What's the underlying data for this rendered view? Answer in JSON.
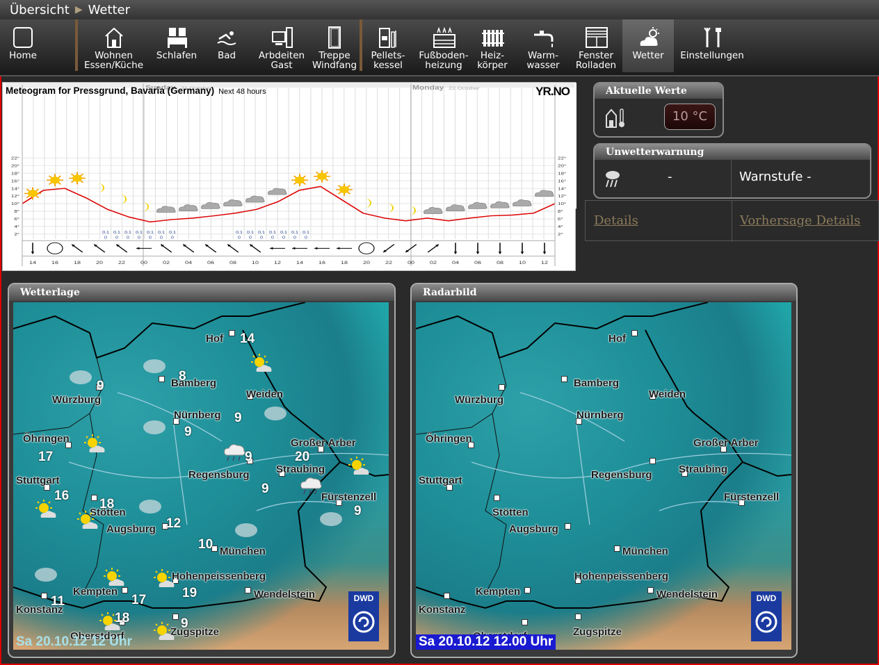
{
  "breadcrumb": {
    "parent": "Übersicht",
    "current": "Wetter"
  },
  "toolbar": [
    {
      "id": "home",
      "line1": "Home",
      "line2": "",
      "icon": "home-icon"
    },
    {
      "id": "wohnen",
      "line1": "Wohnen",
      "line2": "Essen/Küche",
      "icon": "house-icon"
    },
    {
      "id": "schlafen",
      "line1": "Schlafen",
      "line2": "",
      "icon": "bed-icon"
    },
    {
      "id": "bad",
      "line1": "Bad",
      "line2": "",
      "icon": "swimmer-icon"
    },
    {
      "id": "arbeiten",
      "line1": "Arbdeiten",
      "line2": "Gast",
      "icon": "computer-icon"
    },
    {
      "id": "treppe",
      "line1": "Treppe",
      "line2": "Windfang",
      "icon": "door-icon"
    },
    {
      "id": "pellets",
      "line1": "Pellets-",
      "line2": "kessel",
      "icon": "boiler-icon"
    },
    {
      "id": "fussboden",
      "line1": "Fußboden-",
      "line2": "heizung",
      "icon": "floor-heating-icon"
    },
    {
      "id": "heizkoerper",
      "line1": "Heiz-",
      "line2": "körper",
      "icon": "radiator-icon"
    },
    {
      "id": "warmwasser",
      "line1": "Warm-",
      "line2": "wasser",
      "icon": "faucet-icon"
    },
    {
      "id": "fenster",
      "line1": "Fenster",
      "line2": "Rolladen",
      "icon": "window-blind-icon"
    },
    {
      "id": "wetter",
      "line1": "Wetter",
      "line2": "",
      "icon": "weather-icon"
    },
    {
      "id": "einstellungen",
      "line1": "Einstellungen",
      "line2": "",
      "icon": "tools-icon"
    }
  ],
  "meteogram": {
    "title": "Meteogram for Pressgrund, Bavaria (Germany)",
    "subtitle": "Next 48 hours",
    "logo": "YR.NO",
    "day1": "Sunday",
    "day1_date": "21 October",
    "day2": "Monday",
    "day2_date": "22 October"
  },
  "chart_data": {
    "type": "line",
    "title": "Meteogram for Pressgrund, Bavaria (Germany)",
    "x": [
      "14",
      "16",
      "18",
      "20",
      "22",
      "00",
      "02",
      "04",
      "06",
      "08",
      "10",
      "12",
      "14",
      "16",
      "18",
      "20",
      "22",
      "00",
      "02",
      "04",
      "06",
      "08",
      "10",
      "12"
    ],
    "ylim": [
      0,
      23
    ],
    "ytick_labels": [
      "2°",
      "4°",
      "6°",
      "8°",
      "10°",
      "12°",
      "14°",
      "16°",
      "18°",
      "20°",
      "22°"
    ],
    "series": [
      {
        "values": [
          10,
          13.5,
          14,
          11.5,
          8.5,
          6.5,
          5.2,
          5.8,
          6.2,
          6.8,
          7.5,
          8.5,
          10.5,
          13.5,
          14.5,
          11,
          7.5,
          6.2,
          5.5,
          6.2,
          5.5,
          6.2,
          6.8,
          7,
          7.5,
          10
        ]
      }
    ],
    "precipitation": [
      "0.1",
      "0.1",
      "0.1",
      "0.1",
      "0.1",
      "0.1",
      "0.1"
    ],
    "precip_zero": "0",
    "symbols": [
      "sun",
      "sun",
      "sun",
      "moon",
      "moon",
      "moon",
      "cloud",
      "cloud",
      "cloud",
      "cloud",
      "cloud",
      "cloud",
      "sun",
      "sun",
      "sun",
      "moon",
      "moon",
      "moon",
      "cloud",
      "cloud",
      "cloud",
      "cloud",
      "cloud",
      "cloud"
    ],
    "wind_directions": [
      "S",
      "calm",
      "NW",
      "NW",
      "NW",
      "W",
      "NW",
      "NW",
      "NW",
      "NW",
      "NW",
      "W",
      "W",
      "W",
      "W",
      "calm",
      "SW",
      "SW",
      "NE",
      "S",
      "S",
      "S",
      "S",
      "S"
    ]
  },
  "aktuelle_werte": {
    "title": "Aktuelle Werte",
    "temperature": "10 °C"
  },
  "unwetter": {
    "title": "Unwetterwarnung",
    "value": "-",
    "warnstufe_label": "Warnstufe",
    "warnstufe_value": "-"
  },
  "links": {
    "details": "Details",
    "vorhersage": "Vorhersage Details"
  },
  "wetterlage": {
    "title": "Wetterlage",
    "date": "Sa 20.10.12 12 Uhr",
    "cities": [
      "Hof",
      "Bamberg",
      "Würzburg",
      "Weiden",
      "Nürnberg",
      "Öhringen",
      "Großer Arber",
      "Stuttgart",
      "Straubing",
      "Regensburg",
      "Fürstenzell",
      "Stötten",
      "Augsburg",
      "München",
      "Hohenpeissenberg",
      "Kempten",
      "Wendelstein",
      "Konstanz",
      "Oberstdorf",
      "Zugspitze"
    ],
    "temps": [
      "14",
      "8",
      "9",
      "9",
      "9",
      "17",
      "20",
      "16",
      "9",
      "9",
      "9",
      "18",
      "12",
      "10",
      "19",
      "17",
      "11",
      "18",
      "9"
    ]
  },
  "radar": {
    "title": "Radarbild",
    "date": "Sa 20.10.12 12.00 Uhr",
    "cities": [
      "Hof",
      "Bamberg",
      "Würzburg",
      "Weiden",
      "Nürnberg",
      "Öhringen",
      "Großer Arber",
      "Stuttgart",
      "Straubing",
      "Regensburg",
      "Fürstenzell",
      "Stötten",
      "Augsburg",
      "München",
      "Hohenpeissenberg",
      "Kempten",
      "Wendelstein",
      "Konstanz",
      "Oberstdorf",
      "Zugspitze"
    ]
  },
  "dwd_logo": "DWD"
}
